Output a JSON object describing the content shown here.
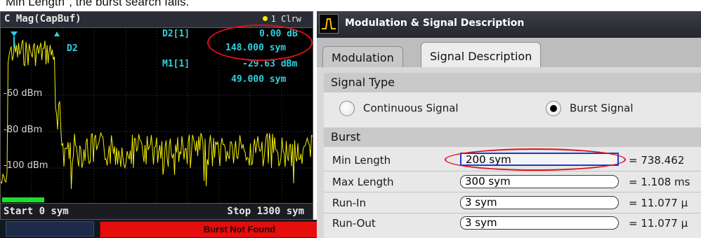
{
  "caption": "Min Length\", the burst search fails.",
  "trace": {
    "title": "C Mag(CapBuf)",
    "badge": "1 Clrw",
    "marker_d2_name": "D2[1]",
    "marker_d2_val1": "0.00 dB",
    "marker_d2_val2": "148.000 sym",
    "marker_m1_name": "M1[1]",
    "marker_m1_val1": "-29.63 dBm",
    "marker_m1_val2": "49.000 sym",
    "d2_tag": "D2",
    "level_60": "-60 dBm",
    "level_80": "-80 dBm",
    "level_100": "-100 dBm",
    "start": "Start 0 sym",
    "stop": "Stop 1300 sym",
    "trace_color": "#f4f000",
    "marker_color": "#2ed0e0"
  },
  "status": {
    "message": "Burst Not Found",
    "color": "#e60d0d"
  },
  "dialog": {
    "title": "Modulation & Signal Description",
    "tabs": [
      {
        "label": "Modulation",
        "active": false
      },
      {
        "label": "Signal Description",
        "active": true
      }
    ],
    "signal_type": {
      "heading": "Signal Type",
      "options": [
        {
          "label": "Continuous Signal",
          "selected": false
        },
        {
          "label": "Burst Signal",
          "selected": true
        }
      ]
    },
    "burst": {
      "heading": "Burst",
      "fields": [
        {
          "label": "Min Length",
          "value": "200 sym",
          "converted": "= 738.462"
        },
        {
          "label": "Max Length",
          "value": "300 sym",
          "converted": "= 1.108 ms"
        },
        {
          "label": "Run-In",
          "value": "3 sym",
          "converted": "= 11.077 µ"
        },
        {
          "label": "Run-Out",
          "value": "3 sym",
          "converted": "= 11.077 µ"
        }
      ]
    }
  }
}
